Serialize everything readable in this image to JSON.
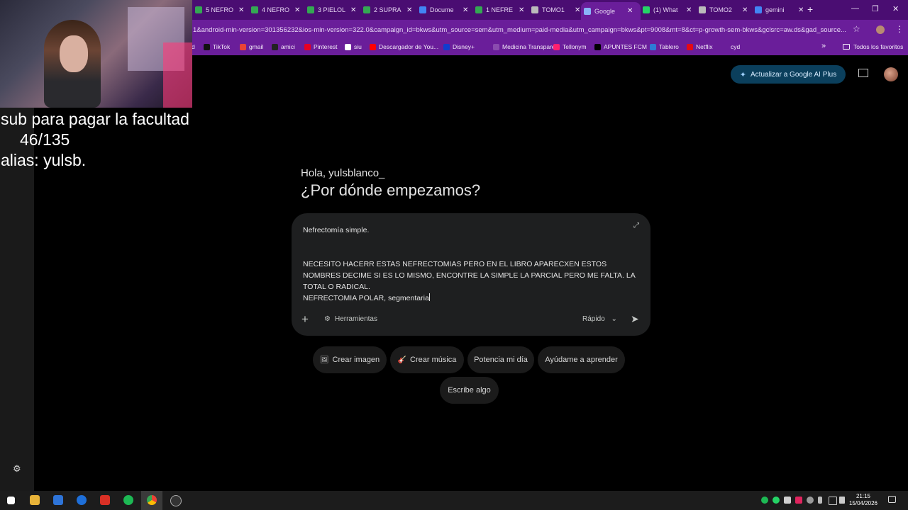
{
  "browser": {
    "tabs": [
      {
        "title": "5 NEFRO",
        "icon_color": "#34a853"
      },
      {
        "title": "4 NEFRO",
        "icon_color": "#34a853"
      },
      {
        "title": "3 PIELOL",
        "icon_color": "#34a853"
      },
      {
        "title": "2 SUPRA",
        "icon_color": "#34a853"
      },
      {
        "title": "Docume",
        "icon_color": "#4285f4"
      },
      {
        "title": "1 NEFRE",
        "icon_color": "#34a853"
      },
      {
        "title": "TOMO1",
        "icon_color": "#bbbbbb"
      },
      {
        "title": "Google",
        "icon_color": "#8ab4f8"
      },
      {
        "title": "(1) What",
        "icon_color": "#25d366"
      },
      {
        "title": "TOMO2",
        "icon_color": "#bbbbbb"
      },
      {
        "title": "gemini",
        "icon_color": "#4285f4"
      }
    ],
    "new_tab_label": "+",
    "url": "1&android-min-version=301356232&ios-min-version=322.0&campaign_id=bkws&utm_source=sem&utm_medium=paid-media&utm_campaign=bkws&pt=9008&mt=8&ct=p-growth-sem-bkws&gclsrc=aw.ds&gad_source...",
    "bookmarks": [
      {
        "label": "TikTok",
        "color": "#111111"
      },
      {
        "label": "gmail",
        "color": "#ea4335"
      },
      {
        "label": "amici",
        "color": "#222222"
      },
      {
        "label": "Pinterest",
        "color": "#e60023"
      },
      {
        "label": "siu",
        "color": "#ffffff"
      },
      {
        "label": "Descargador de You...",
        "color": "#ff0000"
      },
      {
        "label": "Disney+",
        "color": "#113ccf"
      },
      {
        "label": "Medicina Transpare...",
        "color": "#8a4baf"
      },
      {
        "label": "Tellonym",
        "color": "#ff1f6e"
      },
      {
        "label": "APUNTES FCM",
        "color": "#000000"
      },
      {
        "label": "Tablero",
        "color": "#2e7bd6"
      },
      {
        "label": "Netflix",
        "color": "#e50914"
      },
      {
        "label": "cyd",
        "color": "#6a1e9a"
      }
    ],
    "bookmark_all": "Todos los favoritos"
  },
  "gemini": {
    "upgrade_label": "Actualizar a Google AI Plus",
    "greeting": "Hola, yulsblanco_",
    "headline": "¿Por dónde empezamos?",
    "prompt_lines": [
      "Nefrectomía simple.",
      "",
      "NECESITO HACERR ESTAS NEFRECTOMIAS PERO EN EL LIBRO APARECXEN ESTOS NOMBRES DECIME SI ES LO MISMO, ENCONTRE LA SIMPLE LA PARCIAL PERO ME FALTA. LA TOTAL O RADICAL.",
      "NEFRECTOMIA POLAR, segmentaria"
    ],
    "tools_label": "Herramientas",
    "mode_label": "Rápido",
    "chips": [
      {
        "label": "Crear imagen",
        "icon": "🖼"
      },
      {
        "label": "Crear música",
        "icon": "🎸"
      },
      {
        "label": "Potencia mi día",
        "icon": ""
      },
      {
        "label": "Ayúdame a aprender",
        "icon": ""
      },
      {
        "label": "Escribe algo",
        "icon": ""
      }
    ]
  },
  "overlay": {
    "line1": "sub para pagar la facultad",
    "line2": "46/135",
    "line3": "alias: yulsb."
  },
  "taskbar": {
    "time": "21:15",
    "date": "15/04/2026"
  }
}
